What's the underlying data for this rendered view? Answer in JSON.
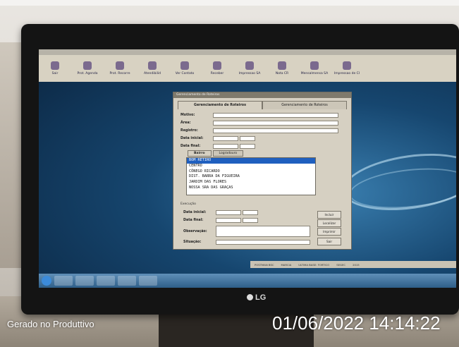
{
  "watermark": {
    "left": "Gerado no Produttivo",
    "right": "01/06/2022 14:14:22"
  },
  "monitor": {
    "brand": "LG"
  },
  "app": {
    "toolbar": [
      "Sair",
      "Prot. Agenda",
      "Prot. Recorre",
      "Atendibilid",
      "Ver Contato",
      "Receber",
      "Impressao SA",
      "Nota CR",
      "Mensalmensa SA",
      "Impressao de CI"
    ]
  },
  "window": {
    "title": "Gerenciamento de Roteiros",
    "tabs": [
      "Gerenciamento de Roteiros",
      "Gerenciamento de Roteiros"
    ],
    "labels": {
      "motivo": "Motivo:",
      "area": "Área:",
      "registro": "Registro:",
      "data_inicial": "Data inicial:",
      "data_final": "Data final:"
    },
    "subtabs": [
      "Bairro",
      "Logradouro"
    ],
    "bairros": [
      "BOM RETIRO",
      "CENTRO",
      "CÔNEGO RICARDO",
      "DIST. BARRA DA FIGUEIRA",
      "JARDIM DAS FLORES",
      "NOSSA SRA DAS GRAÇAS"
    ],
    "section": "Execução",
    "exec_labels": {
      "data_inicial": "Data inicial:",
      "data_final": "Data final:",
      "observacao": "Observação:",
      "situacao": "Situação:"
    },
    "side_buttons": [
      "Incluir",
      "Localizar",
      "Imprimir",
      "Sair"
    ]
  },
  "statusbar": [
    "POSTMAN BSC",
    "MARCIA",
    "ULTIMA BASE: FORTICO",
    "SEGEC",
    "2015"
  ]
}
